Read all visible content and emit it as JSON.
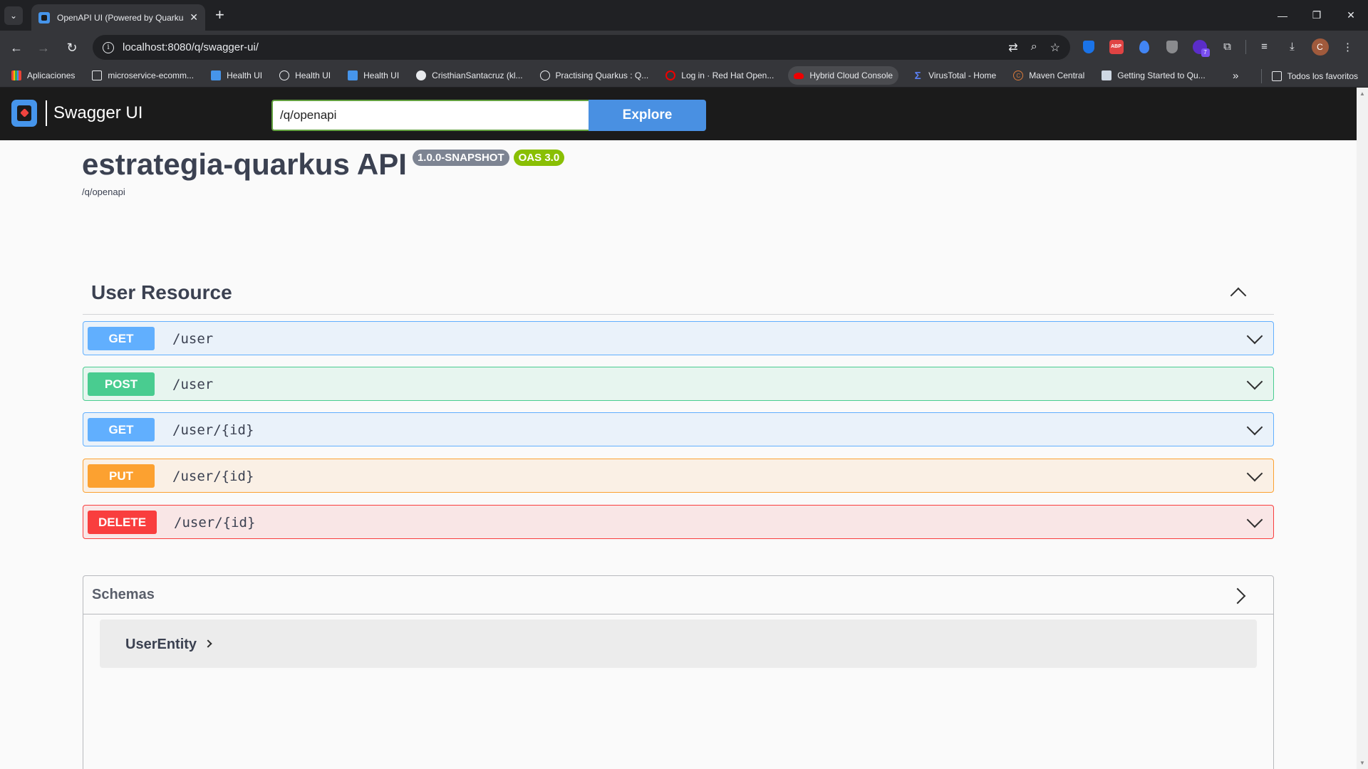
{
  "browser": {
    "tab_title": "OpenAPI UI (Powered by Quarkus",
    "url": "localhost:8080/q/swagger-ui/",
    "bookmarks": [
      {
        "label": "Aplicaciones",
        "icon": "apps-grid-icon"
      },
      {
        "label": "microservice-ecomm...",
        "icon": "folder-icon"
      },
      {
        "label": "Health UI",
        "icon": "quarkus-icon"
      },
      {
        "label": "Health UI",
        "icon": "globe-icon"
      },
      {
        "label": "Health UI",
        "icon": "quarkus-icon"
      },
      {
        "label": "CristhianSantacruz (kl...",
        "icon": "github-icon"
      },
      {
        "label": "Practising Quarkus : Q...",
        "icon": "globe-icon"
      },
      {
        "label": "Log in · Red Hat Open...",
        "icon": "openshift-icon"
      },
      {
        "label": "Hybrid Cloud Console",
        "icon": "redhat-icon"
      },
      {
        "label": "VirusTotal - Home",
        "icon": "virustotal-icon"
      },
      {
        "label": "Maven Central",
        "icon": "maven-icon"
      },
      {
        "label": "Getting Started to Qu...",
        "icon": "info-icon"
      }
    ],
    "all_bookmarks": "Todos los favoritos",
    "profile_initial": "C",
    "extension_badge": "7"
  },
  "swagger": {
    "brand": "Swagger UI",
    "spec_url": "/q/openapi",
    "explore_label": "Explore",
    "api_title": "estrategia-quarkus API",
    "version": "1.0.0-SNAPSHOT",
    "oas": "OAS 3.0",
    "spec_link": "/q/openapi",
    "tag": "User Resource",
    "operations": [
      {
        "method": "GET",
        "path": "/user"
      },
      {
        "method": "POST",
        "path": "/user"
      },
      {
        "method": "GET",
        "path": "/user/{id}"
      },
      {
        "method": "PUT",
        "path": "/user/{id}"
      },
      {
        "method": "DELETE",
        "path": "/user/{id}"
      }
    ],
    "schemas_title": "Schemas",
    "models": [
      "UserEntity"
    ]
  },
  "colors": {
    "get": "#61affe",
    "post": "#49cc90",
    "put": "#fca130",
    "delete": "#f93e3e",
    "oas_badge": "#89bf04",
    "topbar": "#1b1b1b"
  }
}
